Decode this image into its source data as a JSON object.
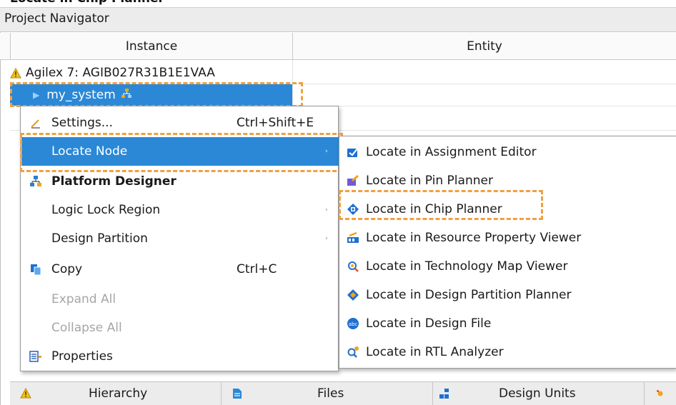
{
  "caption": "Locate in Chip Planner",
  "navigator": {
    "title": "Project Navigator",
    "columns": {
      "instance": "Instance",
      "entity": "Entity"
    },
    "device": "Agilex 7: AGIB027R31B1E1VAA",
    "top_instance": "my_system"
  },
  "context_menu": {
    "items": [
      {
        "label": "Settings...",
        "shortcut": "Ctrl+Shift+E",
        "icon": "settings-icon"
      },
      {
        "label": "Locate Node",
        "submenu": true
      },
      {
        "label": "Platform Designer",
        "icon": "platform-designer-icon"
      },
      {
        "label": "Logic Lock Region",
        "submenu": true
      },
      {
        "label": "Design Partition",
        "submenu": true
      },
      {
        "label": "Copy",
        "shortcut": "Ctrl+C",
        "icon": "copy-icon"
      },
      {
        "label": "Expand All",
        "disabled": true
      },
      {
        "label": "Collapse All",
        "disabled": true
      },
      {
        "label": "Properties",
        "icon": "properties-icon"
      }
    ],
    "submenu_arrow": "›"
  },
  "locate_submenu": {
    "items": [
      {
        "label": "Locate in Assignment Editor",
        "icon": "assignment-editor-icon"
      },
      {
        "label": "Locate in Pin Planner",
        "icon": "pin-planner-icon"
      },
      {
        "label": "Locate in Chip Planner",
        "icon": "chip-planner-icon"
      },
      {
        "label": "Locate in Resource Property Viewer",
        "icon": "resource-property-viewer-icon"
      },
      {
        "label": "Locate in Technology Map Viewer",
        "icon": "technology-map-viewer-icon"
      },
      {
        "label": "Locate in Design Partition Planner",
        "icon": "design-partition-planner-icon"
      },
      {
        "label": "Locate in Design File",
        "icon": "design-file-icon"
      },
      {
        "label": "Locate in RTL Analyzer",
        "icon": "rtl-analyzer-icon"
      }
    ]
  },
  "tabs": [
    {
      "label": "Hierarchy",
      "icon": "hierarchy-icon"
    },
    {
      "label": "Files",
      "icon": "files-icon"
    },
    {
      "label": "Design Units",
      "icon": "design-units-icon"
    }
  ],
  "colors": {
    "selection": "#2a88d6",
    "highlight_outline": "#f0a040"
  }
}
